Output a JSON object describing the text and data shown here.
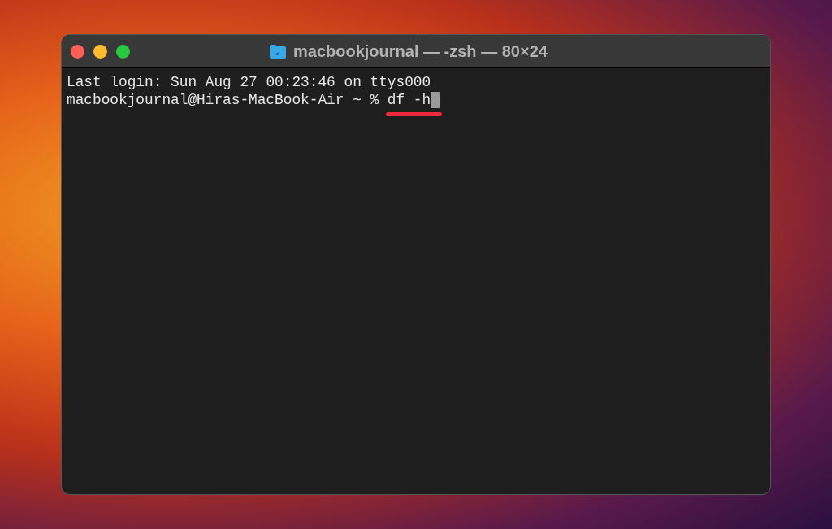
{
  "window": {
    "title": "macbookjournal — -zsh — 80×24"
  },
  "terminal": {
    "lines": [
      {
        "kind": "output",
        "text": "Last login: Sun Aug 27 00:23:46 on ttys000"
      },
      {
        "kind": "prompt",
        "prompt": "macbookjournal@Hiras-MacBook-Air ~ %",
        "command": "df -h",
        "cursor": true,
        "underlined": true
      }
    ]
  }
}
